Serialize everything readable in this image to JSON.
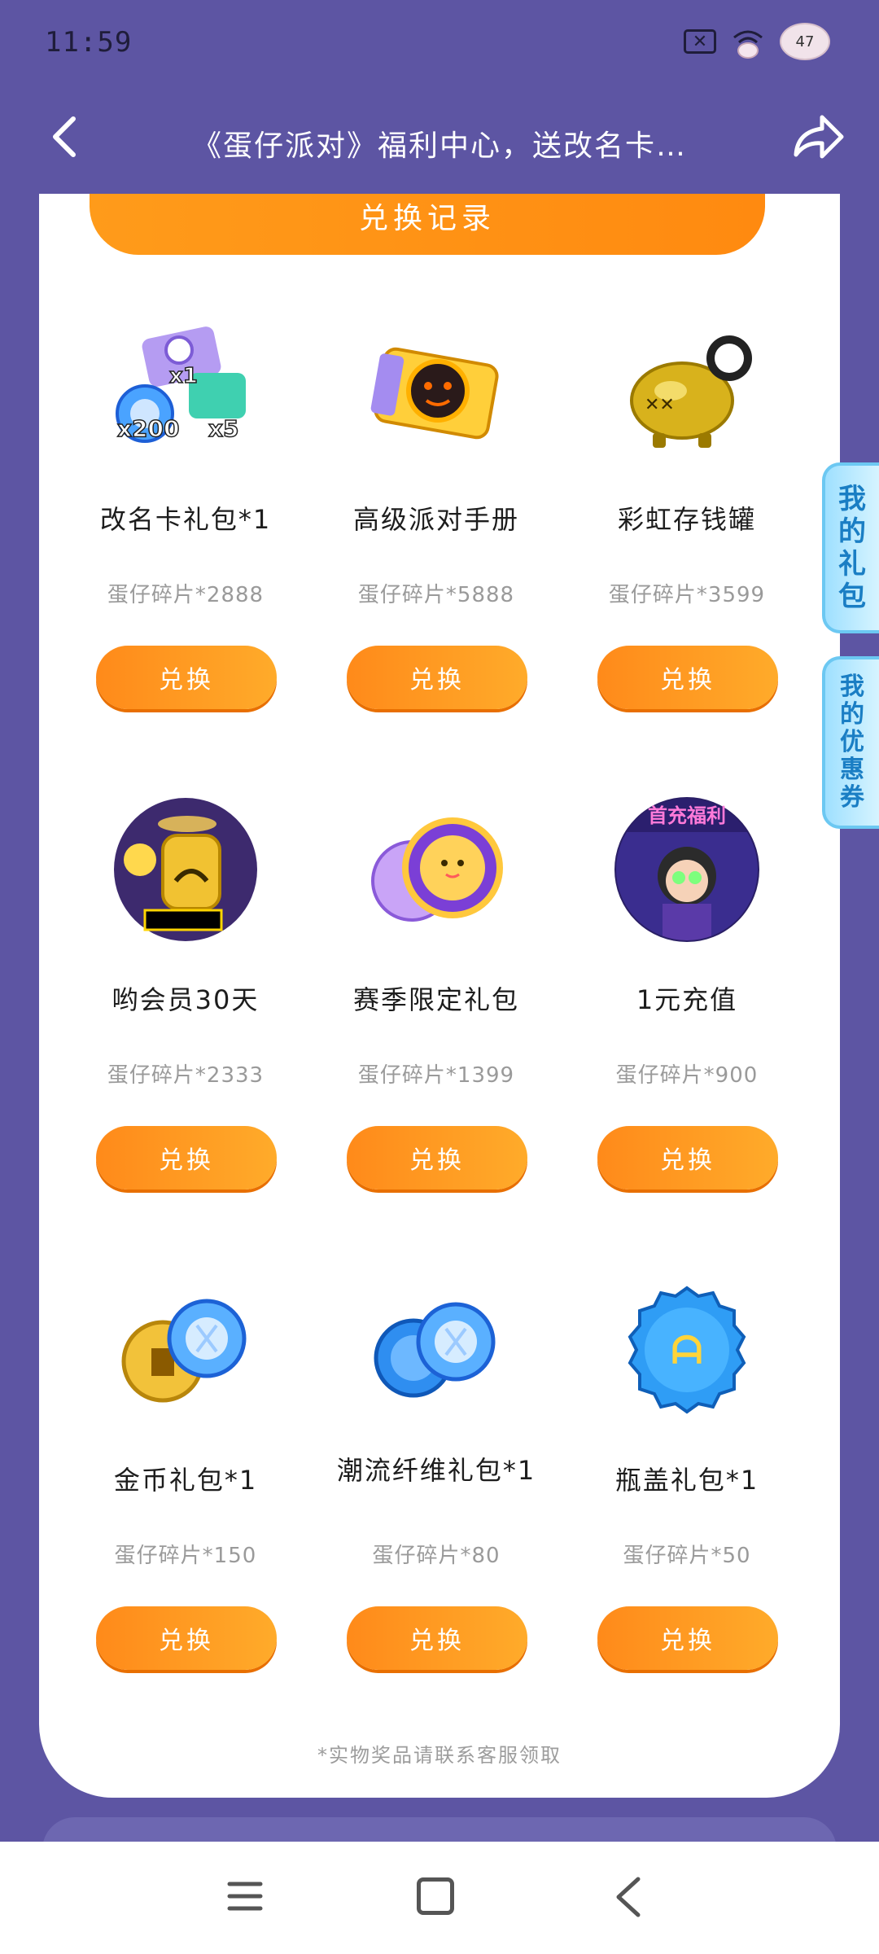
{
  "status_bar": {
    "time": "11:59",
    "battery": "47"
  },
  "header": {
    "title": "《蛋仔派对》福利中心，送改名卡…"
  },
  "records_button": "兑换记录",
  "items": [
    {
      "name": "改名卡礼包*1",
      "cost": "蛋仔碎片*2888",
      "button": "兑换",
      "img_labels": [
        "x1",
        "x200",
        "x5"
      ]
    },
    {
      "name": "高级派对手册",
      "cost": "蛋仔碎片*5888",
      "button": "兑换"
    },
    {
      "name": "彩虹存钱罐",
      "cost": "蛋仔碎片*3599",
      "button": "兑换"
    },
    {
      "name": "哟会员30天",
      "cost": "蛋仔碎片*2333",
      "button": "兑换"
    },
    {
      "name": "赛季限定礼包",
      "cost": "蛋仔碎片*1399",
      "button": "兑换"
    },
    {
      "name": "1元充值",
      "cost": "蛋仔碎片*900",
      "button": "兑换",
      "img_label": "首充福利"
    },
    {
      "name": "金币礼包*1",
      "cost": "蛋仔碎片*150",
      "button": "兑换"
    },
    {
      "name": "潮流纤维礼包*1",
      "cost": "蛋仔碎片*80",
      "button": "兑换"
    },
    {
      "name": "瓶盖礼包*1",
      "cost": "蛋仔碎片*50",
      "button": "兑换"
    }
  ],
  "footnote": "*实物奖品请联系客服领取",
  "side_tabs": {
    "gifts": "我的礼包",
    "coupons": "我的优惠券"
  },
  "colors": {
    "background": "#5d55a3",
    "accent": "#ff9a1f",
    "side_tab": "#9fe0ff"
  }
}
